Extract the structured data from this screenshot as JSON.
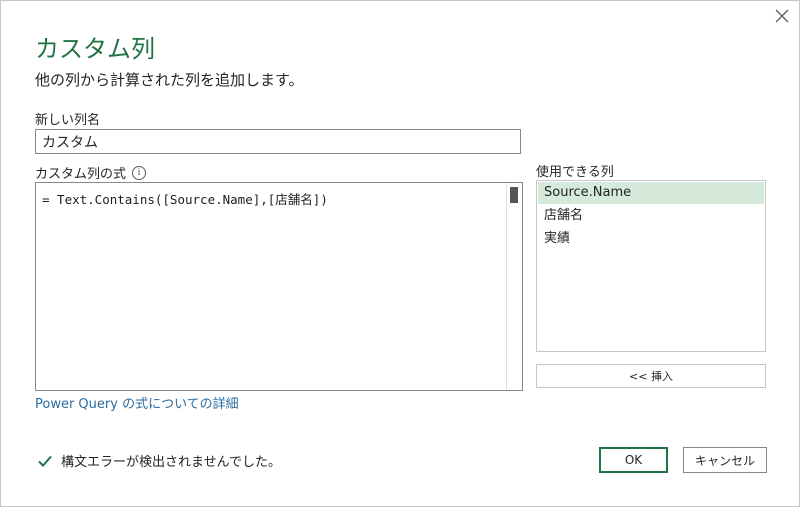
{
  "dialog": {
    "title": "カスタム列",
    "subtitle": "他の列から計算された列を追加します。"
  },
  "column_name": {
    "label": "新しい列名",
    "value": "カスタム"
  },
  "formula": {
    "label": "カスタム列の式",
    "value": "= Text.Contains([Source.Name],[店舗名])"
  },
  "available_columns": {
    "label": "使用できる列",
    "items": [
      "Source.Name",
      "店舗名",
      "実績"
    ],
    "selected": "Source.Name"
  },
  "buttons": {
    "insert": "<< 挿入",
    "ok": "OK",
    "cancel": "キャンセル"
  },
  "link": {
    "text": "Power Query の式についての詳細"
  },
  "status": {
    "text": "構文エラーが検出されませんでした。"
  },
  "colors": {
    "accent": "#217346",
    "selected_row": "#d5eadb",
    "link": "#2b6ca3"
  }
}
